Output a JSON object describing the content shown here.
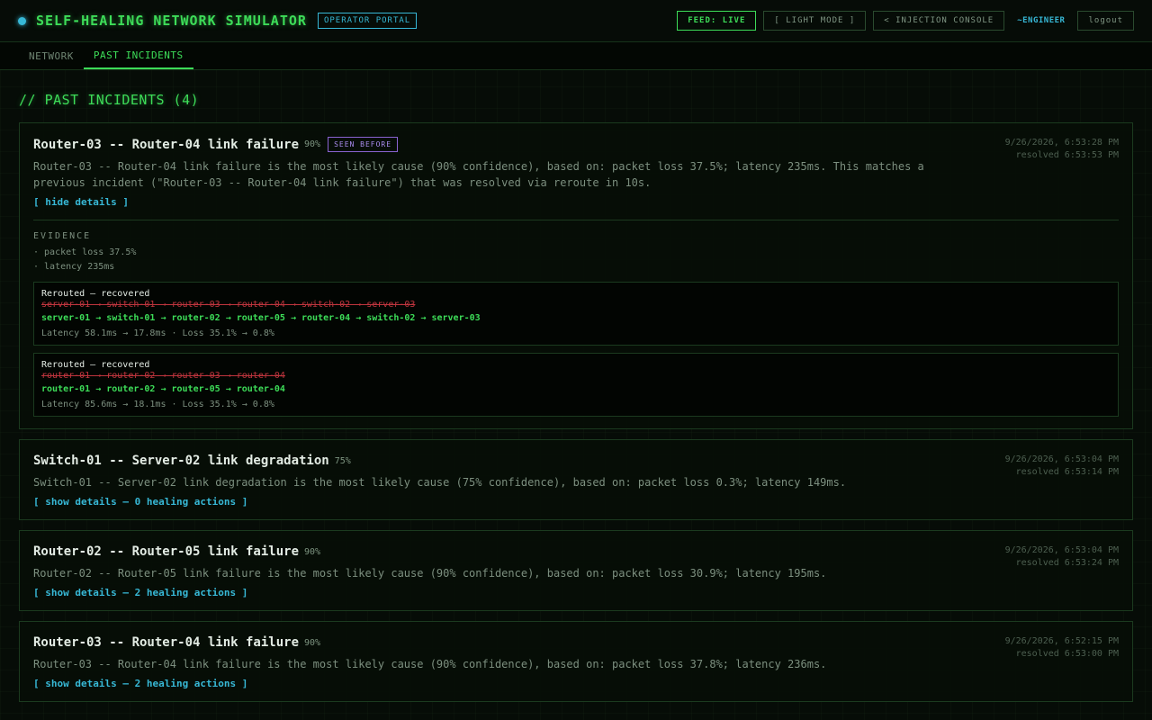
{
  "app": {
    "title": "SELF-HEALING NETWORK SIMULATOR",
    "portal_badge": "OPERATOR PORTAL"
  },
  "header": {
    "feed_label": "FEED: LIVE",
    "light_mode_label": "[ LIGHT MODE ]",
    "injection_console_label": "< INJECTION CONSOLE",
    "user": "~ENGINEER",
    "logout_label": "logout"
  },
  "tabs": [
    {
      "label": "NETWORK"
    },
    {
      "label": "PAST INCIDENTS",
      "active": true
    }
  ],
  "page": {
    "heading": "// PAST INCIDENTS (4)"
  },
  "incidents": [
    {
      "title": "Router-03 -- Router-04 link failure",
      "confidence": "90%",
      "badge": "SEEN BEFORE",
      "time": "9/26/2026, 6:53:28 PM",
      "resolved": "resolved 6:53:53 PM",
      "description": "Router-03 -- Router-04 link failure is the most likely cause (90% confidence), based on: packet loss 37.5%; latency 235ms. This matches a previous incident (\"Router-03 -- Router-04 link failure\") that was resolved via reroute in 10s.",
      "toggle": "[ hide details ]",
      "evidence_title": "EVIDENCE",
      "evidence": [
        "· packet loss 37.5%",
        "· latency 235ms"
      ],
      "actions": [
        {
          "status": "Rerouted — recovered",
          "old_path": "server-01 → switch-01 → router-03 → router-04 → switch-02 → server-03",
          "new_path": "server-01 → switch-01 → router-02 → router-05 → router-04 → switch-02 → server-03",
          "metrics": "Latency 58.1ms → 17.8ms · Loss 35.1% → 0.8%"
        },
        {
          "status": "Rerouted — recovered",
          "old_path": "router-01 → router-02 → router-03 → router-04",
          "new_path": "router-01 → router-02 → router-05 → router-04",
          "metrics": "Latency 85.6ms → 18.1ms · Loss 35.1% → 0.8%"
        }
      ]
    },
    {
      "title": "Switch-01 -- Server-02 link degradation",
      "confidence": "75%",
      "time": "9/26/2026, 6:53:04 PM",
      "resolved": "resolved 6:53:14 PM",
      "description": "Switch-01 -- Server-02 link degradation is the most likely cause (75% confidence), based on: packet loss 0.3%; latency 149ms.",
      "toggle": "[ show details — 0 healing actions ]"
    },
    {
      "title": "Router-02 -- Router-05 link failure",
      "confidence": "90%",
      "time": "9/26/2026, 6:53:04 PM",
      "resolved": "resolved 6:53:24 PM",
      "description": "Router-02 -- Router-05 link failure is the most likely cause (90% confidence), based on: packet loss 30.9%; latency 195ms.",
      "toggle": "[ show details — 2 healing actions ]"
    },
    {
      "title": "Router-03 -- Router-04 link failure",
      "confidence": "90%",
      "time": "9/26/2026, 6:52:15 PM",
      "resolved": "resolved 6:53:00 PM",
      "description": "Router-03 -- Router-04 link failure is the most likely cause (90% confidence), based on: packet loss 37.8%; latency 236ms.",
      "toggle": "[ show details — 2 healing actions ]"
    }
  ]
}
